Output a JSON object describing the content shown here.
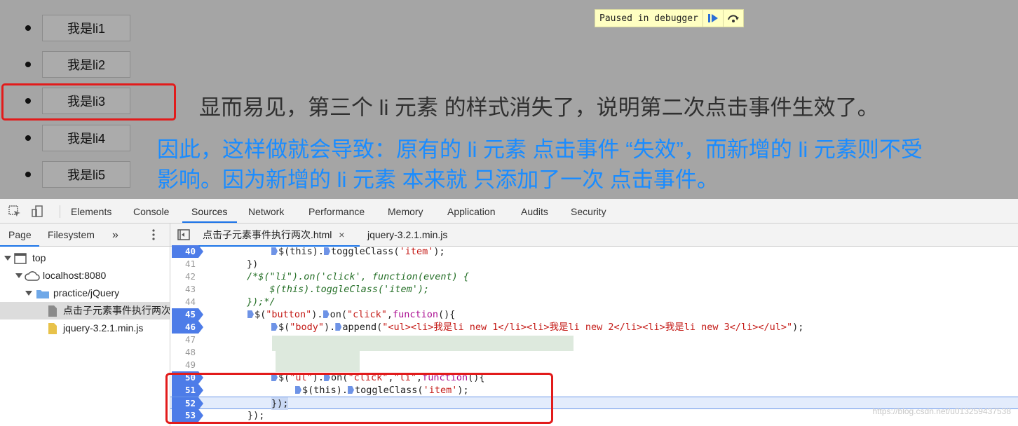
{
  "page": {
    "list_items": [
      "我是li1",
      "我是li2",
      "我是li3",
      "我是li4",
      "我是li5"
    ],
    "paused_label": "Paused in debugger",
    "annotation_black": "显而易见，第三个 li 元素 的样式消失了，说明第二次点击事件生效了。",
    "annotation_blue_line1": "因此，这样做就会导致：原有的 li 元素 点击事件 “失效”，而新增的 li 元素则不受",
    "annotation_blue_line2": "影响。因为新增的 li 元素 本来就 只添加了一次 点击事件。",
    "highlight_color": "#e21b1b",
    "annotation_blue_color": "#1a8cff"
  },
  "devtools": {
    "tabs": [
      "Elements",
      "Console",
      "Sources",
      "Network",
      "Performance",
      "Memory",
      "Application",
      "Audits",
      "Security"
    ],
    "active_tab": "Sources",
    "navigator": {
      "tabs": [
        "Page",
        "Filesystem"
      ],
      "more": "»",
      "tree": [
        {
          "label": "top"
        },
        {
          "label": "localhost:8080"
        },
        {
          "label": "practice/jQuery"
        },
        {
          "label": "点击子元素事件执行两次.html"
        },
        {
          "label": "jquery-3.2.1.min.js"
        }
      ]
    },
    "editor_tabs": [
      "点击子元素事件执行两次.html",
      "jquery-3.2.1.min.js"
    ],
    "close_glyph": "×",
    "code_lines": [
      {
        "num": "40",
        "bp": true
      },
      {
        "num": "41",
        "text": "        })"
      },
      {
        "num": "42",
        "text": "        /*$(\"li\").on('click', function(event) {"
      },
      {
        "num": "43",
        "text": "            $(this).toggleClass('item');"
      },
      {
        "num": "44",
        "text": "        });*/"
      },
      {
        "num": "45",
        "bp": true
      },
      {
        "num": "46",
        "bp": true
      },
      {
        "num": "47",
        "text": ""
      },
      {
        "num": "48",
        "text": ""
      },
      {
        "num": "49",
        "text": ""
      },
      {
        "num": "50",
        "bp": true
      },
      {
        "num": "51",
        "bp": true
      },
      {
        "num": "52",
        "bp": true
      },
      {
        "num": "53",
        "bp": true
      }
    ],
    "watermark": "https://blog.csdn.net/u013259437538"
  }
}
